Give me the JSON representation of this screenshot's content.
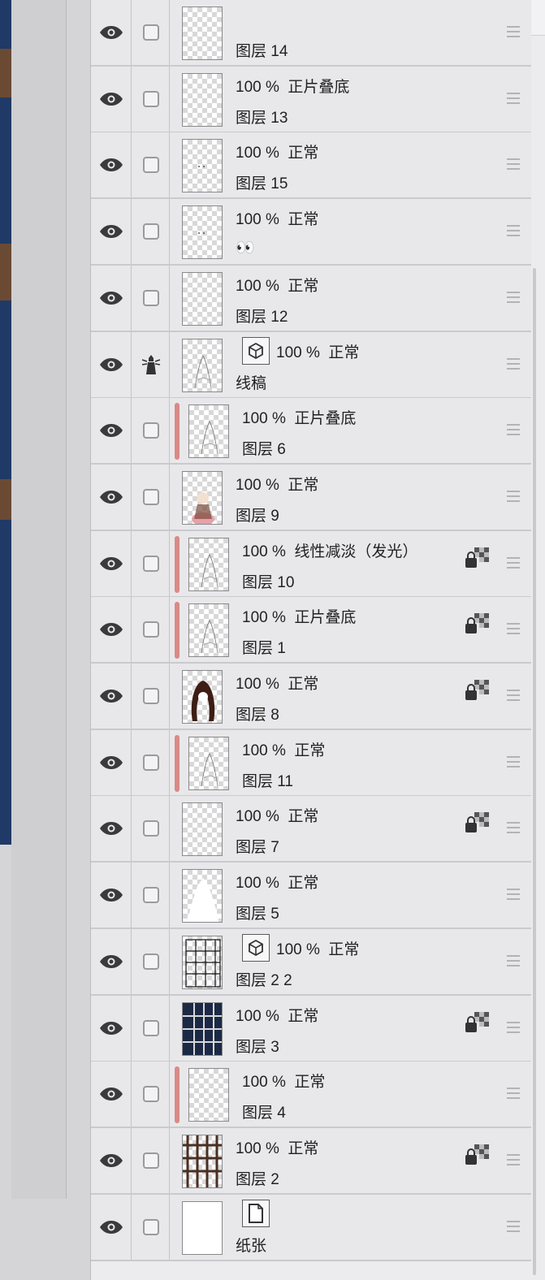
{
  "toolbar": {
    "buttons": [
      {
        "name": "layer-list-icon"
      },
      {
        "name": "new-raster-layer-icon"
      },
      {
        "name": "new-3d-layer-icon"
      },
      {
        "name": "new-folder-icon"
      },
      {
        "name": "merge-down-icon"
      },
      {
        "name": "copy-layer-icon"
      },
      {
        "name": "layer-mask-icon"
      },
      {
        "name": "add-camera-layer-icon"
      },
      {
        "name": "delete-layer-icon"
      }
    ]
  },
  "layers": [
    {
      "mode": "",
      "name": "图层 14",
      "clipped": false,
      "locked": false,
      "type": "raster",
      "thumb": "blank"
    },
    {
      "mode": "100 %  正片叠底",
      "name": "图层 13",
      "clipped": false,
      "locked": false,
      "type": "raster",
      "thumb": "blank"
    },
    {
      "mode": "100 %  正常",
      "name": "图层 15",
      "clipped": false,
      "locked": false,
      "type": "raster",
      "thumb": "dots"
    },
    {
      "mode": "100 %  正常",
      "name": "👀",
      "clipped": false,
      "locked": false,
      "type": "raster",
      "thumb": "dots"
    },
    {
      "mode": "100 %  正常",
      "name": "图层 12",
      "clipped": false,
      "locked": false,
      "type": "raster",
      "thumb": "blank"
    },
    {
      "mode": "100 %  正常",
      "name": "线稿",
      "clipped": false,
      "locked": false,
      "type": "3d",
      "thumb": "sketch",
      "ref_icon": true
    },
    {
      "mode": "100 %  正片叠底",
      "name": "图层 6",
      "clipped": true,
      "locked": false,
      "type": "raster",
      "thumb": "sketch"
    },
    {
      "mode": "100 %  正常",
      "name": "图层 9",
      "clipped": false,
      "locked": false,
      "type": "raster",
      "thumb": "figure-color"
    },
    {
      "mode": "100 %  线性减淡（发光）",
      "name": "图层 10",
      "clipped": true,
      "locked": true,
      "type": "raster",
      "thumb": "sketch"
    },
    {
      "mode": "100 %  正片叠底",
      "name": "图层 1",
      "clipped": true,
      "locked": true,
      "type": "raster",
      "thumb": "sketch"
    },
    {
      "mode": "100 %  正常",
      "name": "图层 8",
      "clipped": false,
      "locked": true,
      "type": "raster",
      "thumb": "hair"
    },
    {
      "mode": "100 %  正常",
      "name": "图层 11",
      "clipped": true,
      "locked": false,
      "type": "raster",
      "thumb": "sketch"
    },
    {
      "mode": "100 %  正常",
      "name": "图层 7",
      "clipped": false,
      "locked": true,
      "type": "raster",
      "thumb": "blank"
    },
    {
      "mode": "100 %  正常",
      "name": "图层 5",
      "clipped": false,
      "locked": false,
      "type": "raster",
      "thumb": "white-shape"
    },
    {
      "mode": "100 %  正常",
      "name": "图层 2 2",
      "clipped": false,
      "locked": false,
      "type": "3d",
      "thumb": "grid-light"
    },
    {
      "mode": "100 %  正常",
      "name": "图层 3",
      "clipped": false,
      "locked": true,
      "type": "raster",
      "thumb": "grid-navy"
    },
    {
      "mode": "100 %  正常",
      "name": "图层 4",
      "clipped": true,
      "locked": false,
      "type": "raster",
      "thumb": "blank"
    },
    {
      "mode": "100 %  正常",
      "name": "图层 2",
      "clipped": false,
      "locked": true,
      "type": "raster",
      "thumb": "grid-brown"
    },
    {
      "mode": "",
      "name": "纸张",
      "clipped": false,
      "locked": false,
      "type": "paper",
      "thumb": "white"
    }
  ]
}
